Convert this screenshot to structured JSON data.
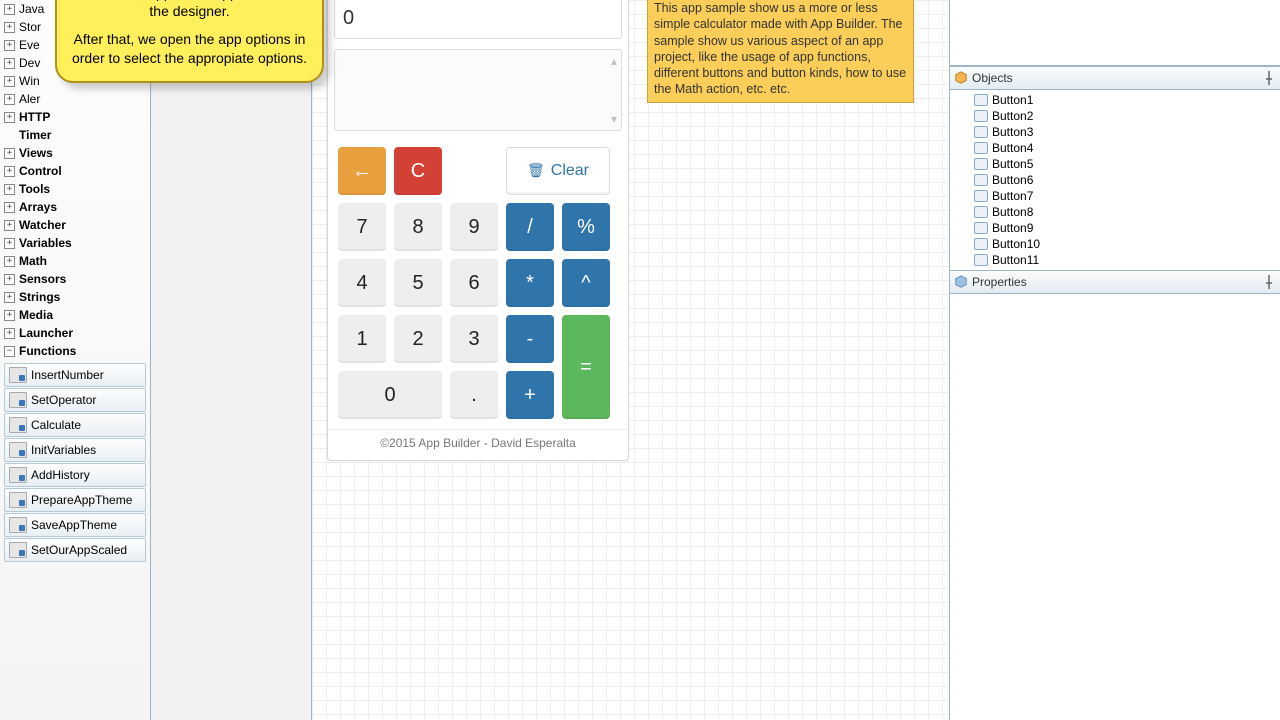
{
  "callout": {
    "line1": "Builder, the app views appear here in the designer.",
    "line2": "After that, we open the app options in order to select the appropiate options."
  },
  "tree": [
    {
      "label": "Java",
      "exp": "plus",
      "bold": false
    },
    {
      "label": "Stor",
      "exp": "plus",
      "bold": false
    },
    {
      "label": "Eve",
      "exp": "plus",
      "bold": false
    },
    {
      "label": "Dev",
      "exp": "plus",
      "bold": false
    },
    {
      "label": "Win",
      "exp": "plus",
      "bold": false
    },
    {
      "label": "Aler",
      "exp": "plus",
      "bold": false
    },
    {
      "label": "HTTP",
      "exp": "plus",
      "bold": true
    },
    {
      "label": "Timer",
      "exp": "none",
      "bold": true
    },
    {
      "label": "Views",
      "exp": "plus",
      "bold": true
    },
    {
      "label": "Control",
      "exp": "plus",
      "bold": true
    },
    {
      "label": "Tools",
      "exp": "plus",
      "bold": true
    },
    {
      "label": "Arrays",
      "exp": "plus",
      "bold": true
    },
    {
      "label": "Watcher",
      "exp": "plus",
      "bold": true
    },
    {
      "label": "Variables",
      "exp": "plus",
      "bold": true
    },
    {
      "label": "Math",
      "exp": "plus",
      "bold": true
    },
    {
      "label": "Sensors",
      "exp": "plus",
      "bold": true
    },
    {
      "label": "Strings",
      "exp": "plus",
      "bold": true
    },
    {
      "label": "Media",
      "exp": "plus",
      "bold": true
    },
    {
      "label": "Launcher",
      "exp": "plus",
      "bold": true
    },
    {
      "label": "Functions",
      "exp": "minus",
      "bold": true
    }
  ],
  "functions": [
    "InsertNumber",
    "SetOperator",
    "Calculate",
    "InitVariables",
    "AddHistory",
    "PrepareAppTheme",
    "SaveAppTheme",
    "SetOurAppScaled"
  ],
  "calc": {
    "display": "0",
    "back": "←",
    "C": "C",
    "clear": "Clear",
    "k7": "7",
    "k8": "8",
    "k9": "9",
    "div": "/",
    "pct": "%",
    "k4": "4",
    "k5": "5",
    "k6": "6",
    "mul": "*",
    "pow": "^",
    "k1": "1",
    "k2": "2",
    "k3": "3",
    "sub": "-",
    "eq": "=",
    "k0": "0",
    "dot": ".",
    "add": "+",
    "footer": "©2015 App Builder - David Esperalta"
  },
  "note": "This app sample show us a more or less simple calculator made with App Builder. The sample show us various aspect of an app project, like the usage of app functions, different buttons and button kinds, how to use the Math action, etc. etc.",
  "panels": {
    "objects": "Objects",
    "properties": "Properties"
  },
  "objects": [
    "Button1",
    "Button2",
    "Button3",
    "Button4",
    "Button5",
    "Button6",
    "Button7",
    "Button8",
    "Button9",
    "Button10",
    "Button11"
  ]
}
